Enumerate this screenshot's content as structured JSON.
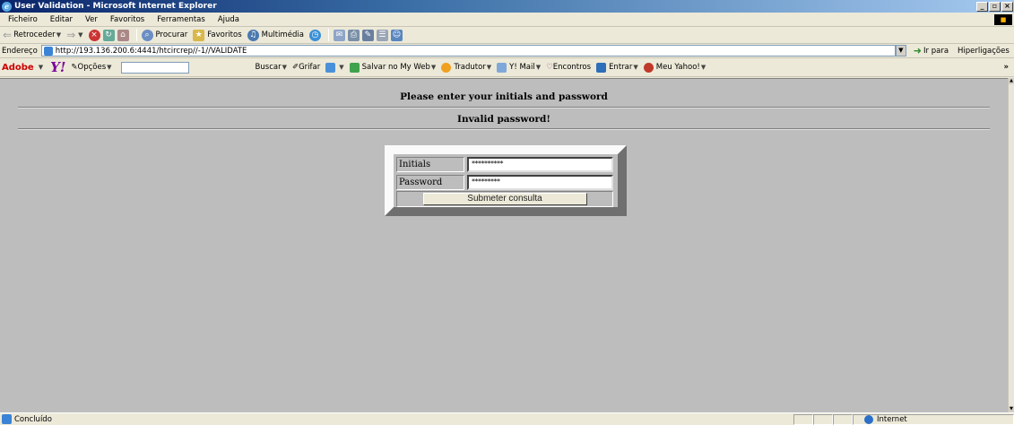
{
  "window": {
    "title": "User Validation - Microsoft Internet Explorer"
  },
  "menu": [
    "Ficheiro",
    "Editar",
    "Ver",
    "Favoritos",
    "Ferramentas",
    "Ajuda"
  ],
  "toolbar": {
    "back": "Retroceder",
    "search": "Procurar",
    "favorites": "Favoritos",
    "multimedia": "Multimédia"
  },
  "address": {
    "label": "Endereço",
    "url": "http://193.136.200.6:4441/htcircrep//-1//VALIDATE",
    "go": "Ir para",
    "links": "Hiperligações"
  },
  "yahoo_bar": {
    "adobe": "Adobe",
    "logo": "Y!",
    "options": "Opções",
    "search_btn": "Buscar",
    "highlight": "Grifar",
    "save_myweb": "Salvar no My Web",
    "translator": "Tradutor",
    "mail": "Y! Mail",
    "meetings": "Encontros",
    "enter": "Entrar",
    "my_yahoo": "Meu Yahoo!",
    "more": "»"
  },
  "page": {
    "heading": "Please enter your initials and password",
    "error": "Invalid password!",
    "form": {
      "initials_label": "Initials",
      "initials_value": "**********",
      "password_label": "Password",
      "password_value": "*********",
      "submit_label": "Submeter consulta"
    }
  },
  "status": {
    "text": "Concluído",
    "zone": "Internet"
  },
  "colors": {
    "title_start": "#0a246a",
    "page_bg": "#bdbdbd",
    "chrome": "#ece9d8"
  }
}
